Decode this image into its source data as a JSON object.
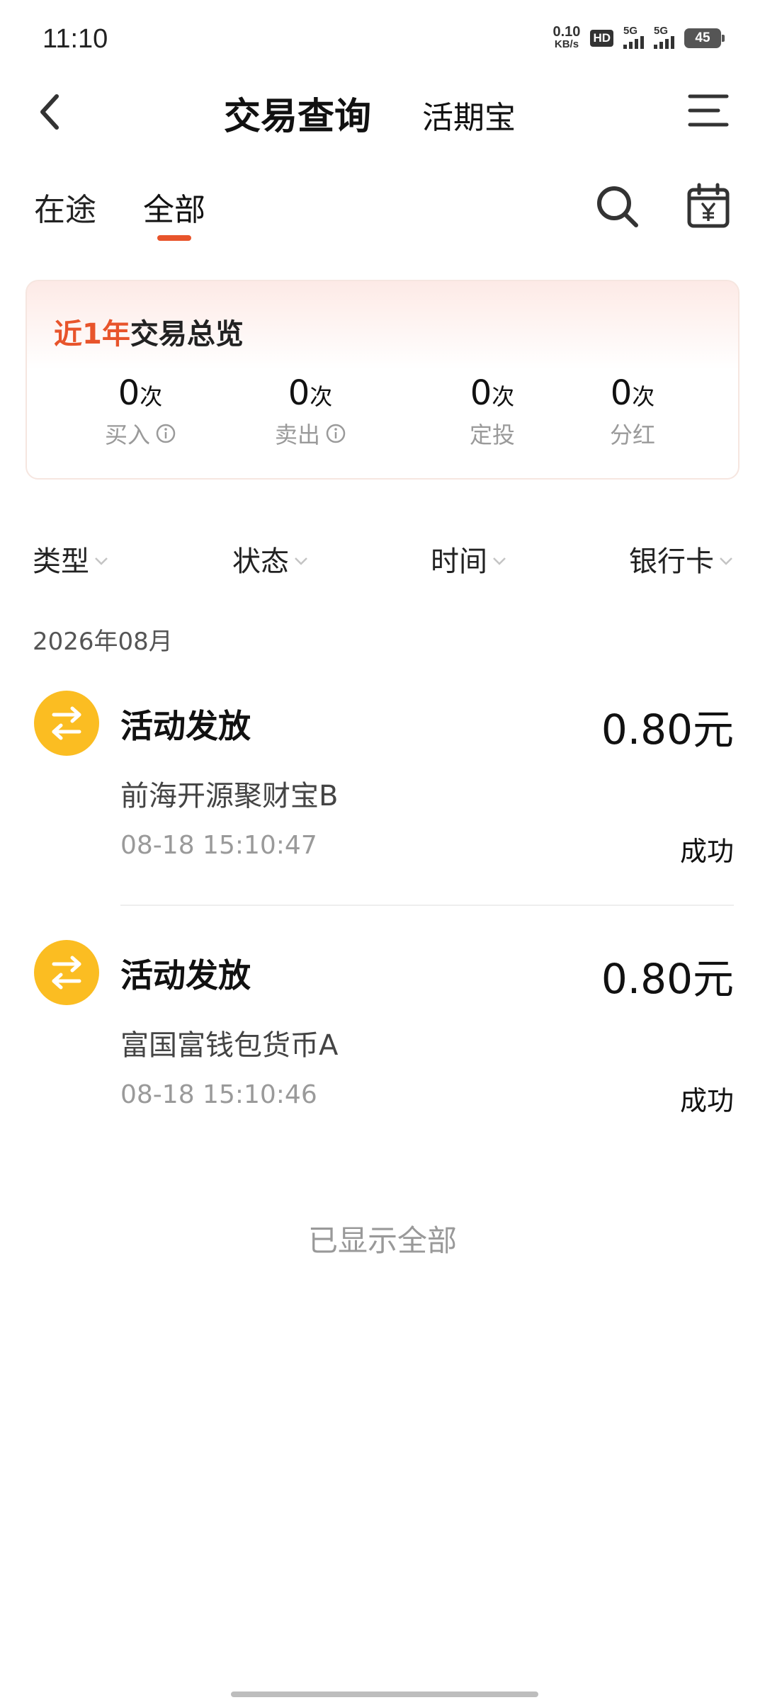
{
  "status_bar": {
    "time": "11:10",
    "net_speed_value": "0.10",
    "net_speed_unit": "KB/s",
    "hd_label": "HD",
    "signal1_label": "5G",
    "signal2_label": "5G",
    "battery": "45"
  },
  "header": {
    "title": "交易查询",
    "subtitle": "活期宝"
  },
  "tabs": [
    {
      "label": "在途"
    },
    {
      "label": "全部",
      "active": true
    }
  ],
  "overview": {
    "title_highlight": "近1年",
    "title_rest": "交易总览",
    "stats": [
      {
        "value": "0",
        "unit": "次",
        "label": "买入"
      },
      {
        "value": "0",
        "unit": "次",
        "label": "卖出"
      },
      {
        "value": "0",
        "unit": "次",
        "label": "定投"
      },
      {
        "value": "0",
        "unit": "次",
        "label": "分红"
      }
    ]
  },
  "filters": [
    {
      "label": "类型"
    },
    {
      "label": "状态"
    },
    {
      "label": "时间"
    },
    {
      "label": "银行卡"
    }
  ],
  "month": "2026年08月",
  "transactions": [
    {
      "type": "活动发放",
      "amount": "0.80元",
      "product": "前海开源聚财宝B",
      "time": "08-18 15:10:47",
      "status": "成功"
    },
    {
      "type": "活动发放",
      "amount": "0.80元",
      "product": "富国富钱包货币A",
      "time": "08-18 15:10:46",
      "status": "成功"
    }
  ],
  "end_text": "已显示全部",
  "colors": {
    "accent": "#e8542b",
    "txn_icon": "#fbbd22"
  }
}
